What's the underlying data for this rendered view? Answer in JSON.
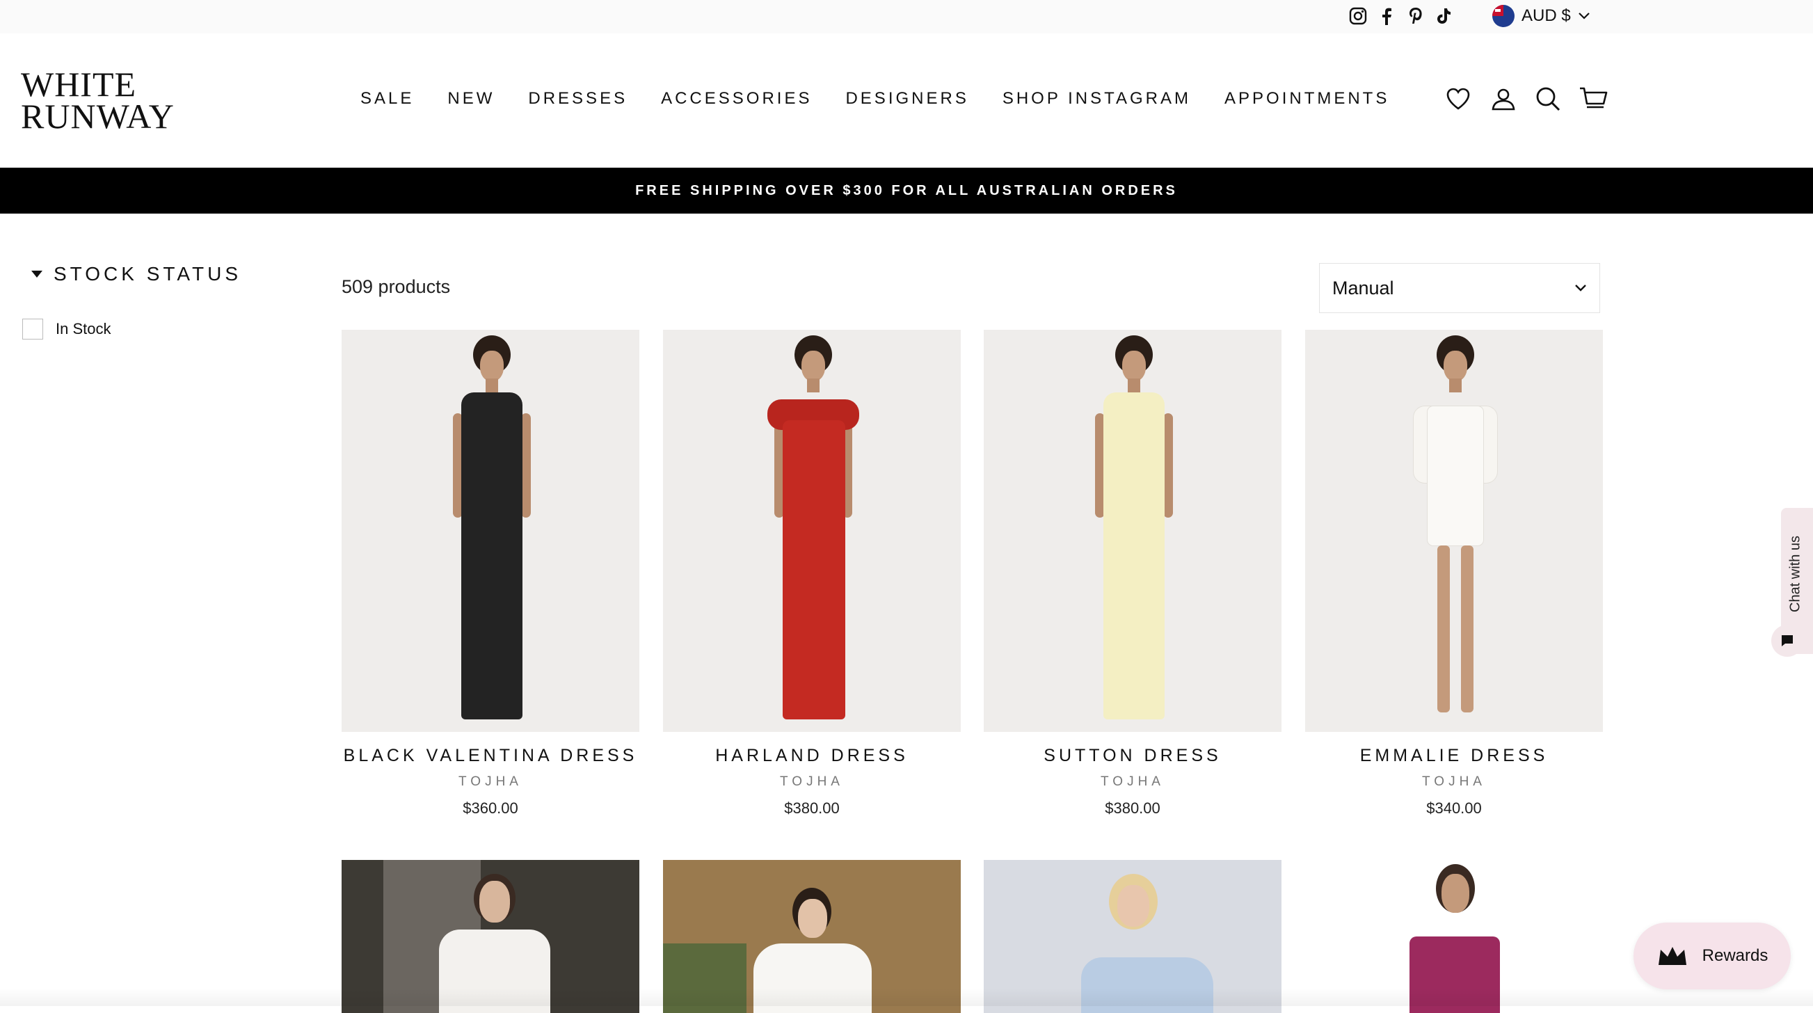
{
  "topbar": {
    "social_icons": [
      "instagram-icon",
      "facebook-icon",
      "pinterest-icon",
      "tiktok-icon"
    ],
    "currency": "AUD $"
  },
  "header": {
    "logo_line1": "WHITE",
    "logo_line2": "RUNWAY",
    "nav": [
      "SALE",
      "NEW",
      "DRESSES",
      "ACCESSORIES",
      "DESIGNERS",
      "SHOP INSTAGRAM",
      "APPOINTMENTS"
    ],
    "icons": [
      "heart-icon",
      "account-icon",
      "search-icon",
      "cart-icon"
    ]
  },
  "banner": {
    "text": "FREE SHIPPING OVER $300 FOR ALL AUSTRALIAN ORDERS"
  },
  "filters": {
    "title": "STOCK STATUS",
    "options": [
      {
        "label": "In Stock",
        "checked": false
      }
    ]
  },
  "listing": {
    "count": "509 products",
    "sort": "Manual",
    "products": [
      {
        "name": "BLACK VALENTINA DRESS",
        "designer": "TOJHA",
        "price": "$360.00",
        "color": "#232323"
      },
      {
        "name": "HARLAND DRESS",
        "designer": "TOJHA",
        "price": "$380.00",
        "color": "#c42a22"
      },
      {
        "name": "SUTTON DRESS",
        "designer": "TOJHA",
        "price": "$380.00",
        "color": "#f4efc3"
      },
      {
        "name": "EMMALIE DRESS",
        "designer": "TOJHA",
        "price": "$340.00",
        "color": "#f7f5f1"
      }
    ],
    "row2_colors": [
      "#f3f1ee",
      "#f7f6f3",
      "#b9cce3",
      "#9c2a5e"
    ]
  },
  "widgets": {
    "chat_label": "Chat with us",
    "rewards_label": "Rewards"
  }
}
